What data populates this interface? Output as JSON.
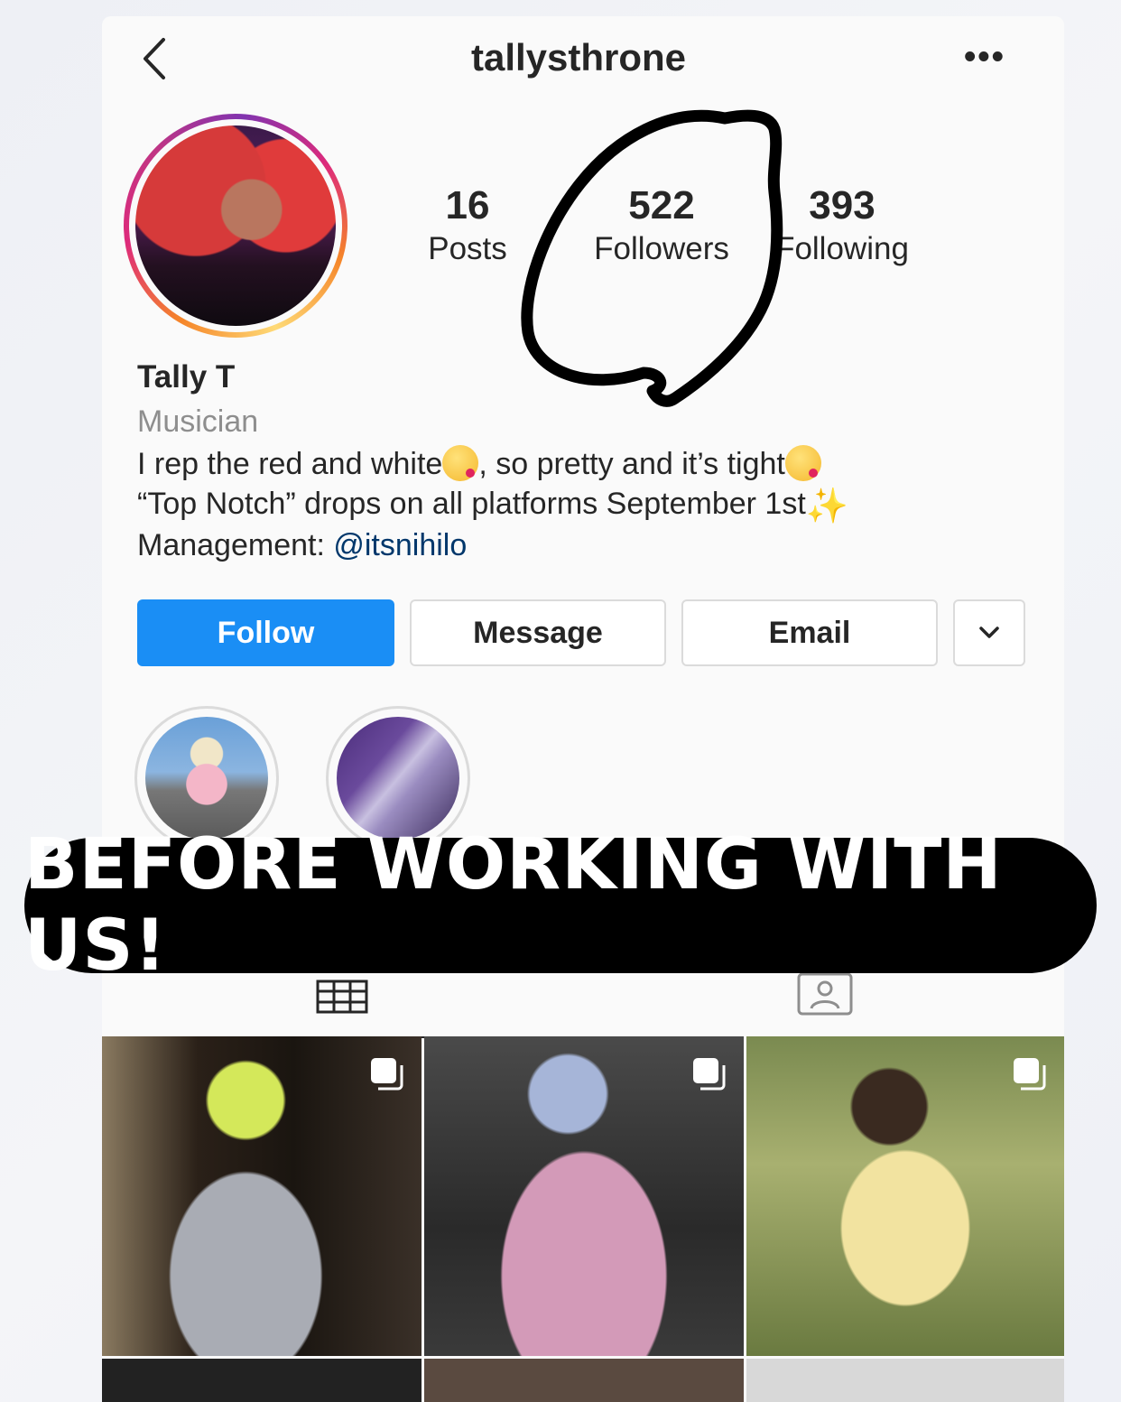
{
  "header": {
    "username": "tallysthrone",
    "back_icon": "chevron-left-icon",
    "more_icon": "ellipsis-icon",
    "more_label": "•••"
  },
  "profile": {
    "stats": {
      "posts_count": "16",
      "posts_label": "Posts",
      "followers_count": "522",
      "followers_label": "Followers",
      "following_count": "393",
      "following_label": "Following"
    },
    "full_name": "Tally T",
    "category": "Musician",
    "bio": {
      "line1_a": "I rep the red and white",
      "line1_b": ", so pretty and it’s tight",
      "line2": "“Top Notch” drops on all platforms September 1st",
      "line3_prefix": "Management: ",
      "line3_mention": "@itsnihilo"
    }
  },
  "actions": {
    "follow_label": "Follow",
    "message_label": "Message",
    "email_label": "Email",
    "dropdown_icon": "chevron-down-icon"
  },
  "tabs": {
    "grid_icon": "grid-icon",
    "tagged_icon": "tagged-icon"
  },
  "overlay": {
    "banner_text": "BEFORE WORKING WITH US!"
  },
  "colors": {
    "follow_button": "#1a8ef5",
    "mention_link": "#00376b",
    "banner_background": "#000000",
    "scribble": "#000000"
  }
}
